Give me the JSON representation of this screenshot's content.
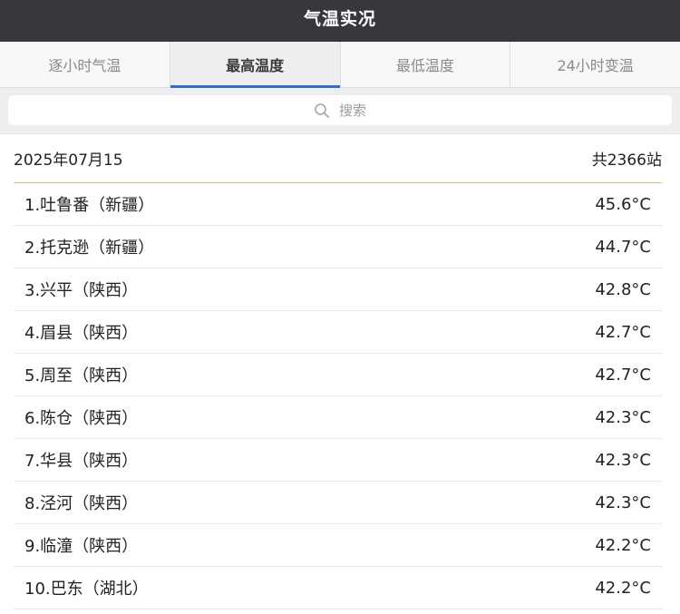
{
  "app": {
    "title": "气温实况"
  },
  "tabs": [
    {
      "label": "逐小时气温"
    },
    {
      "label": "最高温度"
    },
    {
      "label": "最低温度"
    },
    {
      "label": "24小时变温"
    }
  ],
  "search": {
    "placeholder": "搜索",
    "icon": "search-icon"
  },
  "summary": {
    "date": "2025年07月15",
    "count": "共2366站"
  },
  "colors": {
    "accent_tab": "#2f6fc4",
    "header_bg": "#36383d",
    "summary_rule": "#d8c27a"
  },
  "list": [
    {
      "name": "1.吐鲁番（新疆）",
      "temp": "45.6°C"
    },
    {
      "name": "2.托克逊（新疆）",
      "temp": "44.7°C"
    },
    {
      "name": "3.兴平（陕西）",
      "temp": "42.8°C"
    },
    {
      "name": "4.眉县（陕西）",
      "temp": "42.7°C"
    },
    {
      "name": "5.周至（陕西）",
      "temp": "42.7°C"
    },
    {
      "name": "6.陈仓（陕西）",
      "temp": "42.3°C"
    },
    {
      "name": "7.华县（陕西）",
      "temp": "42.3°C"
    },
    {
      "name": "8.泾河（陕西）",
      "temp": "42.3°C"
    },
    {
      "name": "9.临潼（陕西）",
      "temp": "42.2°C"
    },
    {
      "name": "10.巴东（湖北）",
      "temp": "42.2°C"
    }
  ]
}
